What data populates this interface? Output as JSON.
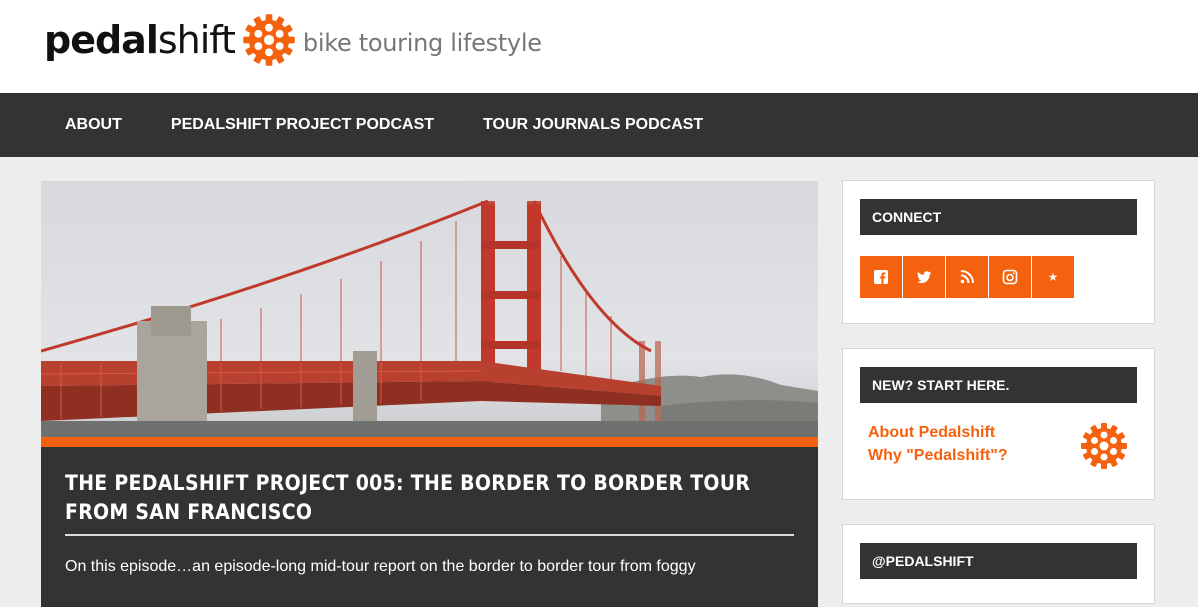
{
  "header": {
    "logo_bold": "pedal",
    "logo_light": "shift",
    "tagline": "bike touring lifestyle",
    "brand_color": "#f5620f"
  },
  "nav": {
    "items": [
      {
        "label": "ABOUT"
      },
      {
        "label": "PEDALSHIFT PROJECT PODCAST"
      },
      {
        "label": "TOUR JOURNALS PODCAST"
      }
    ]
  },
  "post": {
    "hero_image": "golden-gate-bridge-fog-photo",
    "title": "THE PEDALSHIFT PROJECT 005: THE BORDER TO BORDER TOUR FROM SAN FRANCISCO",
    "excerpt": "On this episode…an episode-long mid-tour report on the border to border tour from foggy"
  },
  "sidebar": {
    "connect": {
      "title": "CONNECT",
      "icons": [
        "facebook-icon",
        "twitter-icon",
        "rss-icon",
        "instagram-icon",
        "star-icon"
      ]
    },
    "start_here": {
      "title": "NEW? START HERE.",
      "links": [
        {
          "label": "About Pedalshift"
        },
        {
          "label": "Why \"Pedalshift\"?"
        }
      ]
    },
    "twitter": {
      "title": "@PEDALSHIFT"
    }
  }
}
